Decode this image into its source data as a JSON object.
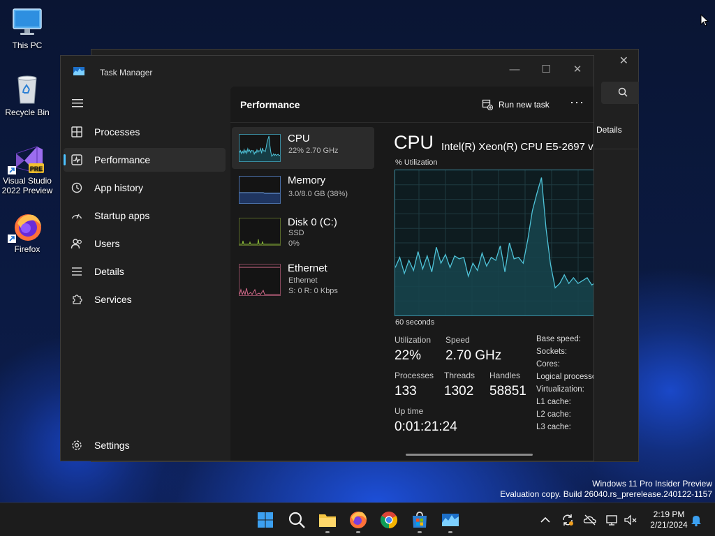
{
  "desktop": {
    "icons": [
      {
        "label": "This PC"
      },
      {
        "label": "Recycle Bin"
      },
      {
        "label": "Visual Studio 2022 Preview",
        "badge": "PRE"
      },
      {
        "label": "Firefox"
      }
    ],
    "watermark_line1": "Windows 11 Pro Insider Preview",
    "watermark_line2": "Evaluation copy. Build 26040.rs_prerelease.240122-1157"
  },
  "back_window": {
    "tab_label": "Details"
  },
  "task_manager": {
    "title": "Task Manager",
    "nav": [
      {
        "label": "Processes",
        "icon": "grid-icon"
      },
      {
        "label": "Performance",
        "icon": "pulse-icon",
        "active": true
      },
      {
        "label": "App history",
        "icon": "history-icon"
      },
      {
        "label": "Startup apps",
        "icon": "speedometer-icon"
      },
      {
        "label": "Users",
        "icon": "users-icon"
      },
      {
        "label": "Details",
        "icon": "list-icon"
      },
      {
        "label": "Services",
        "icon": "puzzle-icon"
      }
    ],
    "settings_label": "Settings",
    "header": {
      "title": "Performance",
      "run_new_task": "Run new task",
      "more": "···"
    },
    "devices": [
      {
        "name": "CPU",
        "sub1": "22%  2.70 GHz",
        "sub2": "",
        "selected": true
      },
      {
        "name": "Memory",
        "sub1": "3.0/8.0 GB (38%)",
        "sub2": ""
      },
      {
        "name": "Disk 0 (C:)",
        "sub1": "SSD",
        "sub2": "0%"
      },
      {
        "name": "Ethernet",
        "sub1": "Ethernet",
        "sub2": "S: 0  R: 0 Kbps"
      }
    ],
    "detail": {
      "heading": "CPU",
      "model": "Intel(R) Xeon(R) CPU E5-2697 v",
      "graph_label": "% Utilization",
      "time_label": "60 seconds",
      "utilization_label": "Utilization",
      "utilization_value": "22%",
      "speed_label": "Speed",
      "speed_value": "2.70 GHz",
      "processes_label": "Processes",
      "processes_value": "133",
      "threads_label": "Threads",
      "threads_value": "1302",
      "handles_label": "Handles",
      "handles_value": "58851",
      "uptime_label": "Up time",
      "uptime_value": "0:01:21:24",
      "specs": [
        "Base speed:",
        "Sockets:",
        "Cores:",
        "Logical processo",
        "Virtualization:",
        "L1 cache:",
        "L2 cache:",
        "L3 cache:"
      ]
    },
    "cpu_history": [
      33,
      40,
      29,
      38,
      31,
      44,
      32,
      41,
      30,
      47,
      36,
      42,
      33,
      41,
      39,
      40,
      27,
      36,
      31,
      43,
      34,
      40,
      38,
      48,
      30,
      50,
      39,
      40,
      36,
      52,
      72,
      84,
      95,
      60,
      35,
      19,
      22,
      28,
      22,
      26,
      22,
      24,
      26,
      21,
      23
    ]
  },
  "taskbar": {
    "clock_time": "2:19 PM",
    "clock_date": "2/21/2024"
  },
  "colors": {
    "accent": "#4cc2ff",
    "cpu_line": "#4fc3d8",
    "memory_line": "#6f9fe0",
    "disk_line": "#8fbf3a",
    "ethernet_line": "#d26a8a"
  }
}
